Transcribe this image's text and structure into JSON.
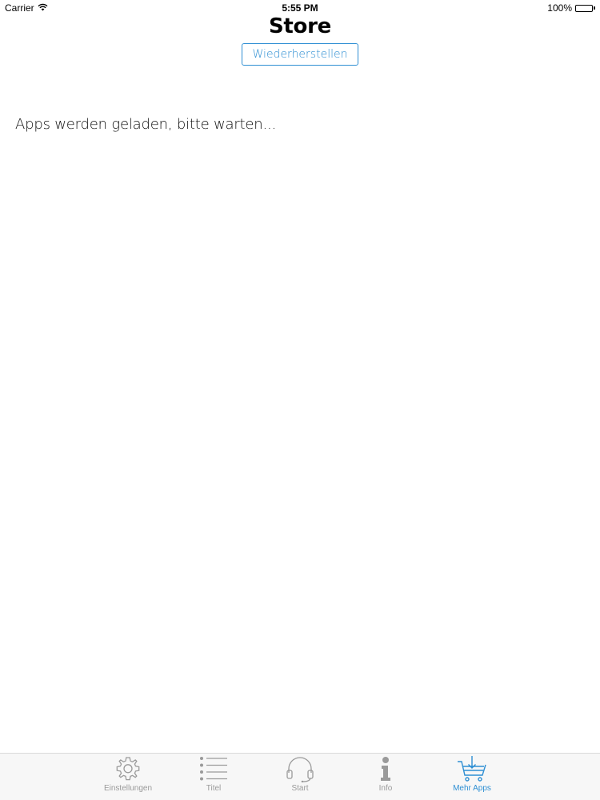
{
  "status_bar": {
    "carrier": "Carrier",
    "time": "5:55 PM",
    "battery": "100%"
  },
  "header": {
    "title": "Store",
    "restore_label": "Wiederherstellen"
  },
  "main": {
    "loading_text": "Apps werden geladen, bitte warten..."
  },
  "tab_bar": {
    "tabs": [
      {
        "label": "Einstellungen",
        "icon": "gear-icon",
        "active": false
      },
      {
        "label": "Titel",
        "icon": "list-icon",
        "active": false
      },
      {
        "label": "Start",
        "icon": "headphones-icon",
        "active": false
      },
      {
        "label": "Info",
        "icon": "info-icon",
        "active": false
      },
      {
        "label": "Mehr Apps",
        "icon": "cart-icon",
        "active": true
      }
    ]
  },
  "colors": {
    "accent": "#2f8fd3",
    "inactive": "#9a9a9a"
  }
}
